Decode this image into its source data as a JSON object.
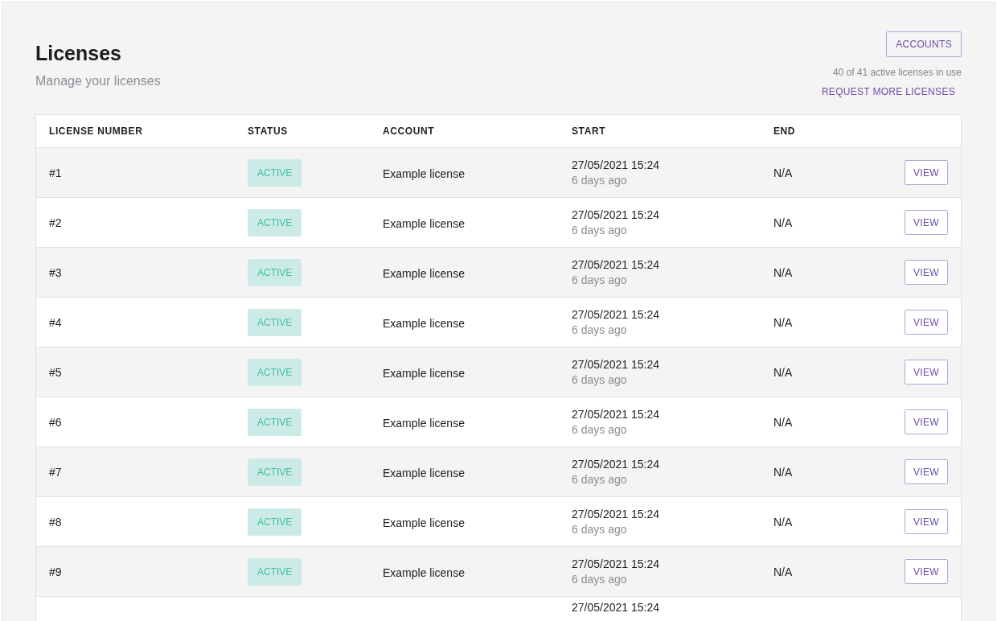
{
  "header": {
    "title": "Licenses",
    "subtitle": "Manage your licenses",
    "accounts_button": "ACCOUNTS",
    "usage": "40 of 41 active licenses in use",
    "request_link": "REQUEST MORE LICENSES"
  },
  "table": {
    "columns": [
      "LICENSE NUMBER",
      "STATUS",
      "ACCOUNT",
      "START",
      "END"
    ],
    "rows": [
      {
        "number": "#1",
        "status": "ACTIVE",
        "account": "Example license",
        "start": "27/05/2021 15:24",
        "ago": "6 days ago",
        "end": "N/A",
        "action": "VIEW"
      },
      {
        "number": "#2",
        "status": "ACTIVE",
        "account": "Example license",
        "start": "27/05/2021 15:24",
        "ago": "6 days ago",
        "end": "N/A",
        "action": "VIEW"
      },
      {
        "number": "#3",
        "status": "ACTIVE",
        "account": "Example license",
        "start": "27/05/2021 15:24",
        "ago": "6 days ago",
        "end": "N/A",
        "action": "VIEW"
      },
      {
        "number": "#4",
        "status": "ACTIVE",
        "account": "Example license",
        "start": "27/05/2021 15:24",
        "ago": "6 days ago",
        "end": "N/A",
        "action": "VIEW"
      },
      {
        "number": "#5",
        "status": "ACTIVE",
        "account": "Example license",
        "start": "27/05/2021 15:24",
        "ago": "6 days ago",
        "end": "N/A",
        "action": "VIEW"
      },
      {
        "number": "#6",
        "status": "ACTIVE",
        "account": "Example license",
        "start": "27/05/2021 15:24",
        "ago": "6 days ago",
        "end": "N/A",
        "action": "VIEW"
      },
      {
        "number": "#7",
        "status": "ACTIVE",
        "account": "Example license",
        "start": "27/05/2021 15:24",
        "ago": "6 days ago",
        "end": "N/A",
        "action": "VIEW"
      },
      {
        "number": "#8",
        "status": "ACTIVE",
        "account": "Example license",
        "start": "27/05/2021 15:24",
        "ago": "6 days ago",
        "end": "N/A",
        "action": "VIEW"
      },
      {
        "number": "#9",
        "status": "ACTIVE",
        "account": "Example license",
        "start": "27/05/2021 15:24",
        "ago": "6 days ago",
        "end": "N/A",
        "action": "VIEW"
      },
      {
        "start": "27/05/2021 15:24"
      }
    ]
  }
}
